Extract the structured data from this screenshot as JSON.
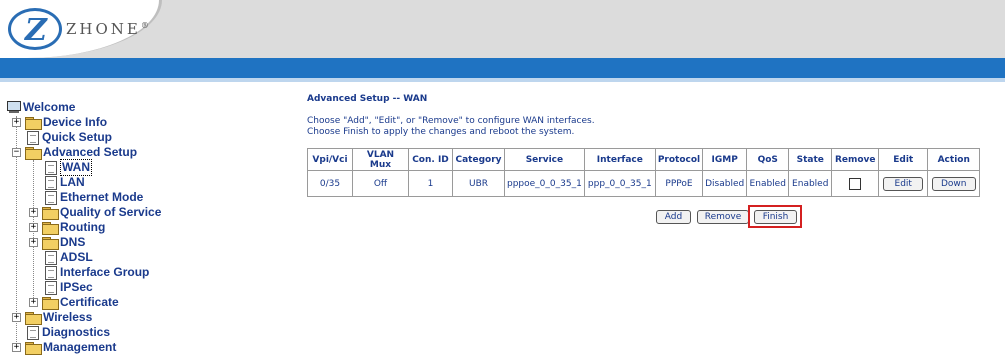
{
  "header": {
    "logo_text": "ZHONE",
    "logo_mark": "Z",
    "trademark": "®"
  },
  "tree": {
    "welcome": "Welcome",
    "device_info": "Device Info",
    "quick_setup": "Quick Setup",
    "advanced_setup": "Advanced Setup",
    "wan": "WAN",
    "lan": "LAN",
    "ethernet_mode": "Ethernet Mode",
    "qos": "Quality of Service",
    "routing": "Routing",
    "dns": "DNS",
    "adsl": "ADSL",
    "interface_group": "Interface Group",
    "ipsec": "IPSec",
    "certificate": "Certificate",
    "wireless": "Wireless",
    "diagnostics": "Diagnostics",
    "management": "Management"
  },
  "main": {
    "title": "Advanced Setup -- WAN",
    "desc_line1": "Choose \"Add\", \"Edit\", or \"Remove\" to configure WAN interfaces.",
    "desc_line2": "Choose Finish to apply the changes and reboot the system.",
    "table": {
      "headers": [
        "Vpi/Vci",
        "VLAN Mux",
        "Con. ID",
        "Category",
        "Service",
        "Interface",
        "Protocol",
        "IGMP",
        "QoS",
        "State",
        "Remove",
        "Edit",
        "Action"
      ],
      "row": {
        "vpivci": "0/35",
        "vlan_mux": "Off",
        "con_id": "1",
        "category": "UBR",
        "service": "pppoe_0_0_35_1",
        "interface": "ppp_0_0_35_1",
        "protocol": "PPPoE",
        "igmp": "Disabled",
        "qos": "Enabled",
        "state": "Enabled",
        "edit_label": "Edit",
        "action_label": "Down"
      }
    },
    "buttons": {
      "add": "Add",
      "remove": "Remove",
      "finish": "Finish"
    },
    "highlight_color": "#d42020"
  }
}
